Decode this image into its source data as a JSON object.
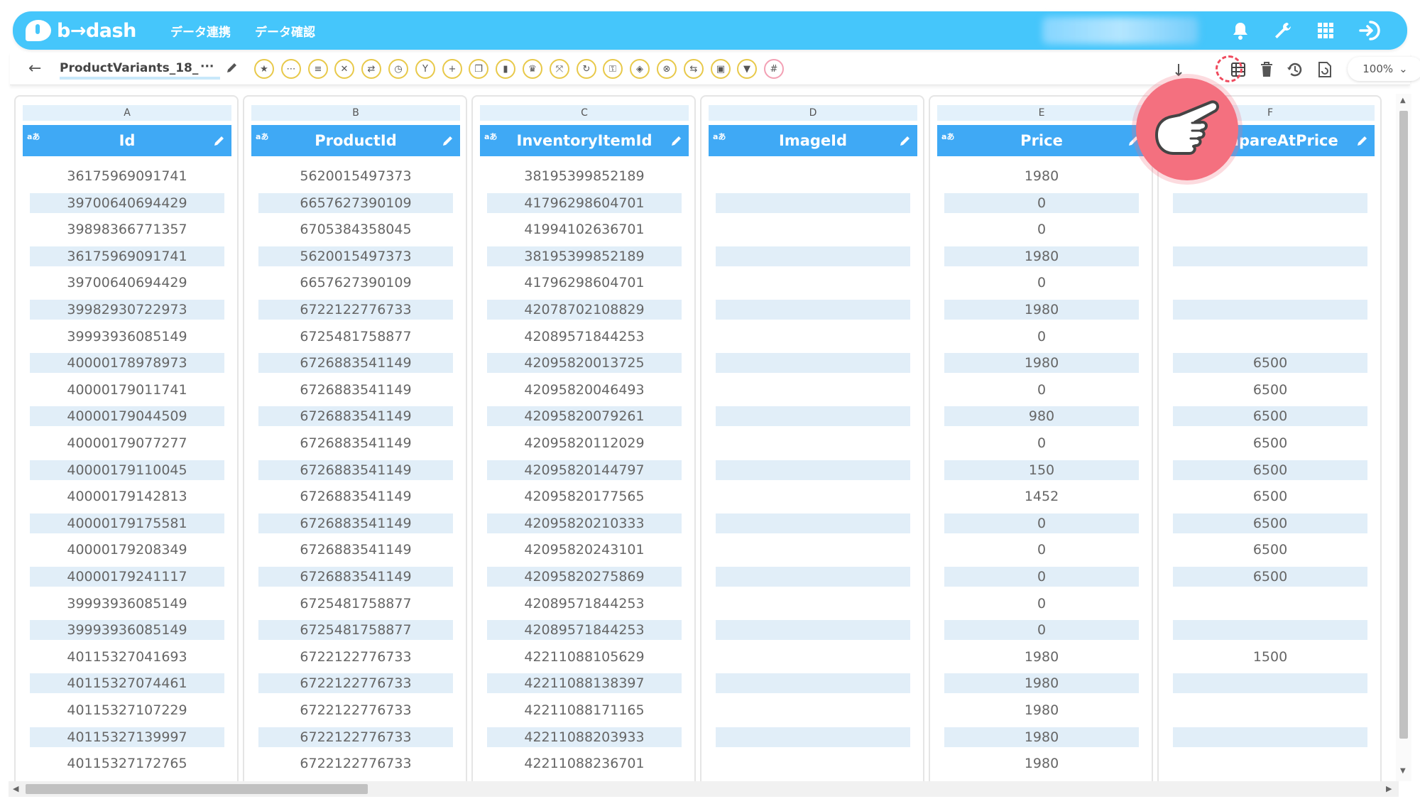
{
  "header": {
    "logo_text": "b→dash",
    "nav": [
      "データ連携",
      "データ確認"
    ],
    "icons": [
      "bell-icon",
      "wrench-icon",
      "grid-apps-icon",
      "logout-icon"
    ]
  },
  "toolbar": {
    "back": "←",
    "file_name": "ProductVariants_18_",
    "file_ellipsis": "···",
    "zoom": "100%",
    "zoom_caret": "⌄",
    "icons": [
      {
        "name": "favorite-star-icon",
        "glyph": "★"
      },
      {
        "name": "more-icon",
        "glyph": "⋯"
      },
      {
        "name": "list-icon",
        "glyph": "≡"
      },
      {
        "name": "tools-icon",
        "glyph": "✕"
      },
      {
        "name": "shuffle-icon",
        "glyph": "⇄"
      },
      {
        "name": "timer-icon",
        "glyph": "◷"
      },
      {
        "name": "merge-icon",
        "glyph": "Y"
      },
      {
        "name": "add-icon",
        "glyph": "+"
      },
      {
        "name": "copy-icon",
        "glyph": "❐"
      },
      {
        "name": "delete-icon",
        "glyph": "▮"
      },
      {
        "name": "crown-icon",
        "glyph": "♛"
      },
      {
        "name": "expand-icon",
        "glyph": "⤧"
      },
      {
        "name": "repeat-icon",
        "glyph": "↻"
      },
      {
        "name": "lock-icon",
        "glyph": "⚿"
      },
      {
        "name": "box-icon",
        "glyph": "◈"
      },
      {
        "name": "cancel-icon",
        "glyph": "⊗"
      },
      {
        "name": "replace-icon",
        "glyph": "⇆"
      },
      {
        "name": "frame-icon",
        "glyph": "▣"
      },
      {
        "name": "filter-icon",
        "glyph": "▼"
      },
      {
        "name": "hash-icon",
        "glyph": "#"
      }
    ],
    "right_icons": [
      "row-table-icon",
      "trash-icon",
      "history-icon",
      "refresh-document-icon"
    ]
  },
  "columns": [
    {
      "letter": "A",
      "name": "Id",
      "type": "aあ",
      "cells": [
        "36175969091741",
        "39700640694429",
        "39898366771357",
        "36175969091741",
        "39700640694429",
        "39982930722973",
        "39993936085149",
        "40000178978973",
        "40000179011741",
        "40000179044509",
        "40000179077277",
        "40000179110045",
        "40000179142813",
        "40000179175581",
        "40000179208349",
        "40000179241117",
        "39993936085149",
        "39993936085149",
        "40115327041693",
        "40115327074461",
        "40115327107229",
        "40115327139997",
        "40115327172765"
      ]
    },
    {
      "letter": "B",
      "name": "ProductId",
      "type": "aあ",
      "cells": [
        "5620015497373",
        "6657627390109",
        "6705384358045",
        "5620015497373",
        "6657627390109",
        "6722122776733",
        "6725481758877",
        "6726883541149",
        "6726883541149",
        "6726883541149",
        "6726883541149",
        "6726883541149",
        "6726883541149",
        "6726883541149",
        "6726883541149",
        "6726883541149",
        "6725481758877",
        "6725481758877",
        "6722122776733",
        "6722122776733",
        "6722122776733",
        "6722122776733",
        "6722122776733"
      ]
    },
    {
      "letter": "C",
      "name": "InventoryItemId",
      "type": "aあ",
      "cells": [
        "38195399852189",
        "41796298604701",
        "41994102636701",
        "38195399852189",
        "41796298604701",
        "42078702108829",
        "42089571844253",
        "42095820013725",
        "42095820046493",
        "42095820079261",
        "42095820112029",
        "42095820144797",
        "42095820177565",
        "42095820210333",
        "42095820243101",
        "42095820275869",
        "42089571844253",
        "42089571844253",
        "42211088105629",
        "42211088138397",
        "42211088171165",
        "42211088203933",
        "42211088236701"
      ]
    },
    {
      "letter": "D",
      "name": "ImageId",
      "type": "aあ",
      "cells": [
        "",
        "",
        "",
        "",
        "",
        "",
        "",
        "",
        "",
        "",
        "",
        "",
        "",
        "",
        "",
        "",
        "",
        "",
        "",
        "",
        "",
        "",
        ""
      ]
    },
    {
      "letter": "E",
      "name": "Price",
      "type": "aあ",
      "cells": [
        "1980",
        "0",
        "0",
        "1980",
        "0",
        "1980",
        "0",
        "1980",
        "0",
        "980",
        "0",
        "150",
        "1452",
        "0",
        "0",
        "0",
        "0",
        "0",
        "1980",
        "1980",
        "1980",
        "1980",
        "1980"
      ]
    },
    {
      "letter": "F",
      "name": "CompareAtPrice",
      "type": "aあ",
      "cells": [
        "",
        "",
        "",
        "",
        "",
        "",
        "",
        "6500",
        "6500",
        "6500",
        "6500",
        "6500",
        "6500",
        "6500",
        "6500",
        "6500",
        "",
        "",
        "1500",
        "",
        "",
        "",
        ""
      ]
    }
  ]
}
